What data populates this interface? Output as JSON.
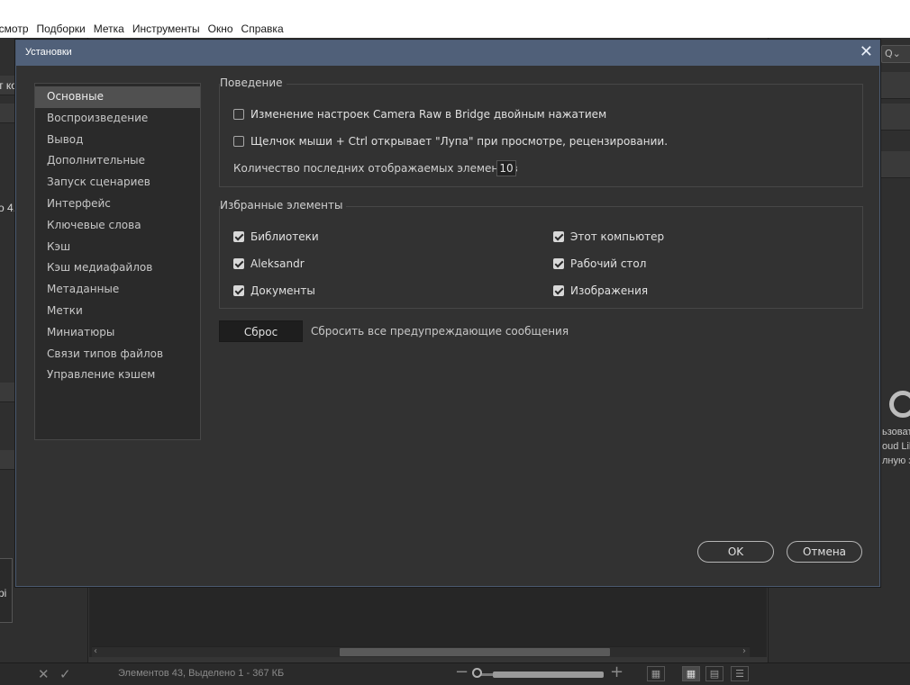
{
  "menubar": {
    "items": [
      "осмотр",
      "Подборки",
      "Метка",
      "Инструменты",
      "Окно",
      "Справка"
    ]
  },
  "app": {
    "left_fragments": [
      "т ко",
      "о 4.",
      "pi"
    ],
    "right_search_label": "Q⌄",
    "right_fragments": [
      "ьзоват",
      "oud Lib",
      "лную за"
    ],
    "status": {
      "text": "Элементов 43, Выделено 1 - 367 КБ",
      "zoom_fraction": 0.12
    }
  },
  "dialog": {
    "title": "Установки",
    "categories": [
      "Основные",
      "Воспроизведение",
      "Вывод",
      "Дополнительные",
      "Запуск сценариев",
      "Интерфейс",
      "Ключевые слова",
      "Кэш",
      "Кэш медиафайлов",
      "Метаданные",
      "Метки",
      "Миниатюры",
      "Связи типов файлов",
      "Управление кэшем"
    ],
    "selected_category": "Основные",
    "behavior": {
      "label": "Поведение",
      "options": [
        {
          "label": "Изменение настроек Camera Raw в Bridge двойным нажатием",
          "checked": false
        },
        {
          "label": "Щелчок мыши + Ctrl открывает \"Лупа\" при просмотре, рецензировании.",
          "checked": false
        }
      ],
      "recent_label": "Количество последних отображаемых элементов",
      "recent_value": "10"
    },
    "favorites": {
      "label": "Избранные элементы",
      "left": [
        {
          "label": "Библиотеки",
          "checked": true
        },
        {
          "label": "Aleksandr",
          "checked": true
        },
        {
          "label": "Документы",
          "checked": true
        }
      ],
      "right": [
        {
          "label": "Этот компьютер",
          "checked": true
        },
        {
          "label": "Рабочий стол",
          "checked": true
        },
        {
          "label": "Изображения",
          "checked": true
        }
      ]
    },
    "reset_button": "Сброс",
    "reset_text": "Сбросить все предупреждающие сообщения",
    "ok_button": "OK",
    "cancel_button": "Отмена"
  }
}
